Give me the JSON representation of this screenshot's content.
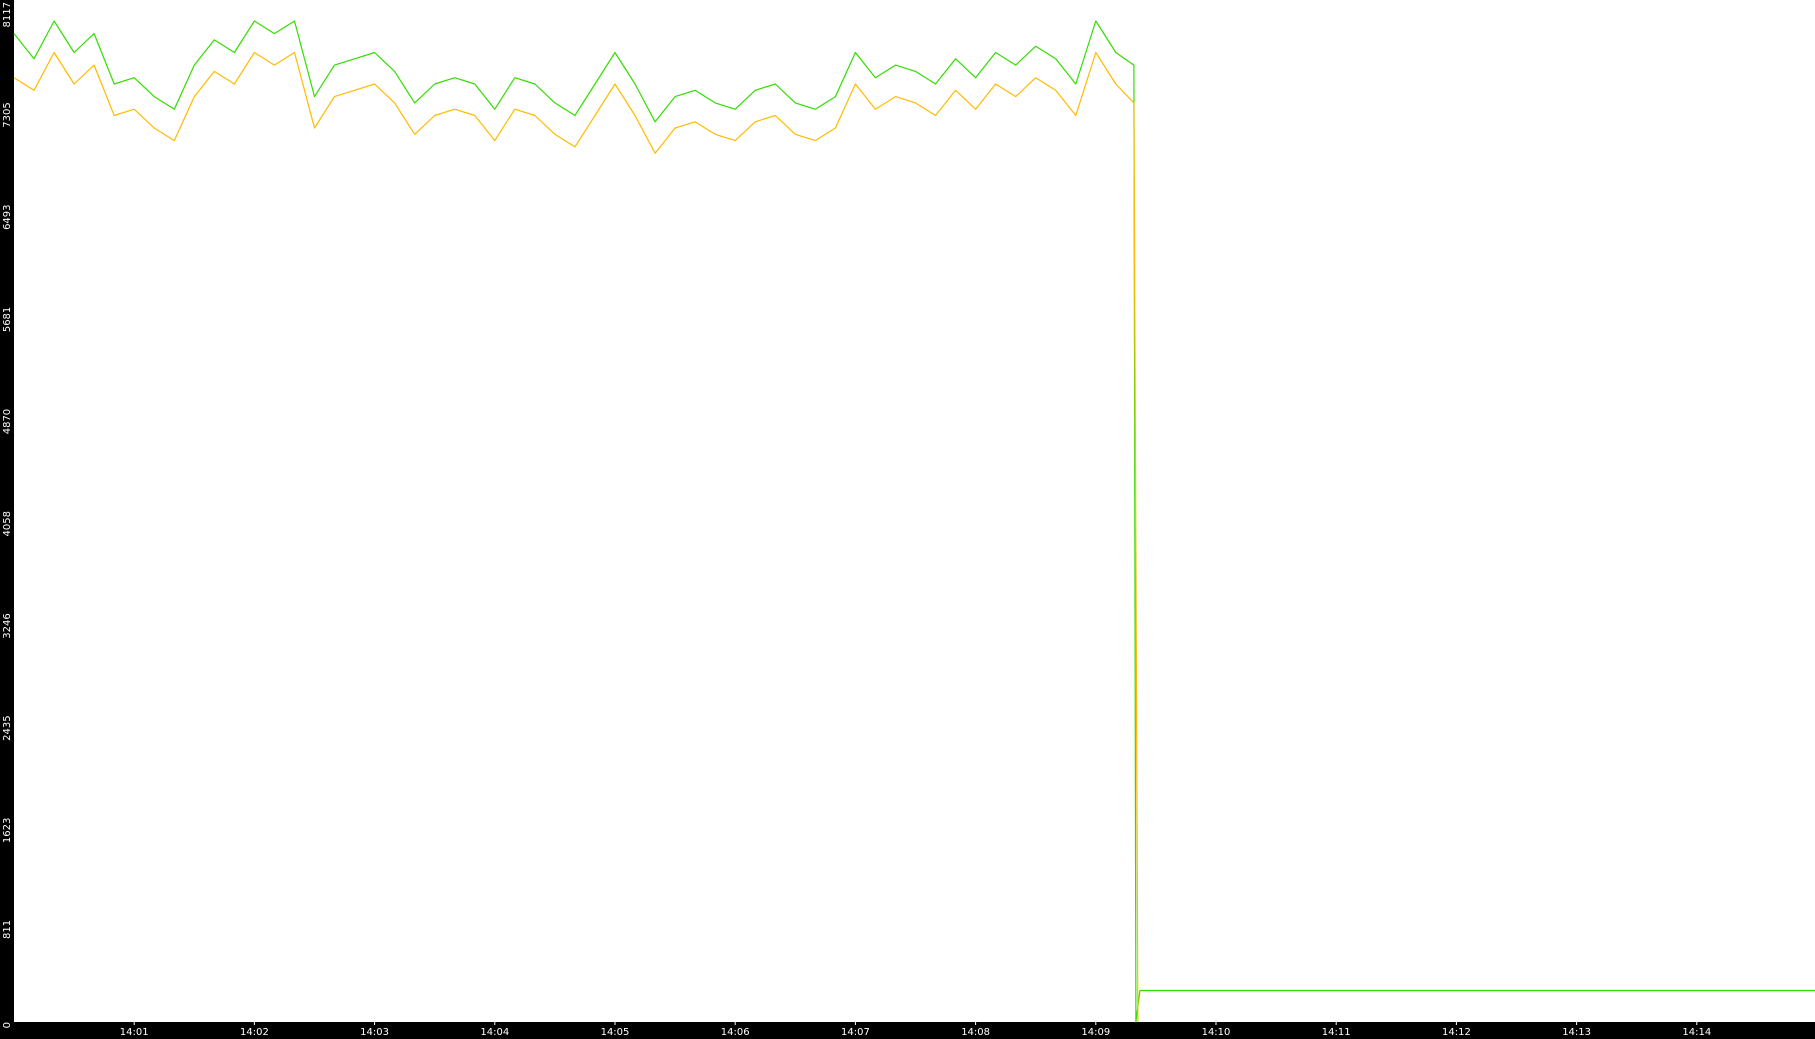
{
  "chart_data": {
    "type": "line",
    "title": "",
    "xlabel": "",
    "ylabel": "",
    "colors": {
      "background": "#ffffff",
      "axis_band": "#000000",
      "tick_text": "#ffffff",
      "series_green": "#33dd00",
      "series_orange": "#ffbb00"
    },
    "y_axis": {
      "range": [
        0,
        8117
      ],
      "ticks": [
        "0",
        "811",
        "1623",
        "2435",
        "3246",
        "4058",
        "4870",
        "5681",
        "6493",
        "7305",
        "8117"
      ]
    },
    "x_axis": {
      "range": [
        "14:00:00",
        "14:14:59"
      ],
      "ticks": [
        "14:01",
        "14:02",
        "14:03",
        "14:04",
        "14:05",
        "14:06",
        "14:07",
        "14:08",
        "14:09",
        "14:10",
        "14:11",
        "14:12",
        "14:13",
        "14:14"
      ]
    },
    "grid": false,
    "legend": "none",
    "series": [
      {
        "color": "#33dd00",
        "points": [
          [
            "14:00:00",
            7850
          ],
          [
            "14:00:10",
            7650
          ],
          [
            "14:00:20",
            7950
          ],
          [
            "14:00:30",
            7700
          ],
          [
            "14:00:40",
            7850
          ],
          [
            "14:00:50",
            7450
          ],
          [
            "14:01:00",
            7500
          ],
          [
            "14:01:10",
            7350
          ],
          [
            "14:01:20",
            7250
          ],
          [
            "14:01:30",
            7600
          ],
          [
            "14:01:40",
            7800
          ],
          [
            "14:01:50",
            7700
          ],
          [
            "14:02:00",
            7950
          ],
          [
            "14:02:10",
            7850
          ],
          [
            "14:02:20",
            7950
          ],
          [
            "14:02:30",
            7350
          ],
          [
            "14:02:40",
            7600
          ],
          [
            "14:02:50",
            7650
          ],
          [
            "14:03:00",
            7700
          ],
          [
            "14:03:10",
            7550
          ],
          [
            "14:03:20",
            7300
          ],
          [
            "14:03:30",
            7450
          ],
          [
            "14:03:40",
            7500
          ],
          [
            "14:03:50",
            7450
          ],
          [
            "14:04:00",
            7250
          ],
          [
            "14:04:10",
            7500
          ],
          [
            "14:04:20",
            7450
          ],
          [
            "14:04:30",
            7300
          ],
          [
            "14:04:40",
            7200
          ],
          [
            "14:04:50",
            7450
          ],
          [
            "14:05:00",
            7700
          ],
          [
            "14:05:10",
            7450
          ],
          [
            "14:05:20",
            7150
          ],
          [
            "14:05:30",
            7350
          ],
          [
            "14:05:40",
            7400
          ],
          [
            "14:05:50",
            7300
          ],
          [
            "14:06:00",
            7250
          ],
          [
            "14:06:10",
            7400
          ],
          [
            "14:06:20",
            7450
          ],
          [
            "14:06:30",
            7300
          ],
          [
            "14:06:40",
            7250
          ],
          [
            "14:06:50",
            7350
          ],
          [
            "14:07:00",
            7700
          ],
          [
            "14:07:10",
            7500
          ],
          [
            "14:07:20",
            7600
          ],
          [
            "14:07:30",
            7550
          ],
          [
            "14:07:40",
            7450
          ],
          [
            "14:07:50",
            7650
          ],
          [
            "14:08:00",
            7500
          ],
          [
            "14:08:10",
            7700
          ],
          [
            "14:08:20",
            7600
          ],
          [
            "14:08:30",
            7750
          ],
          [
            "14:08:40",
            7650
          ],
          [
            "14:08:50",
            7450
          ],
          [
            "14:09:00",
            7950
          ],
          [
            "14:09:10",
            7700
          ],
          [
            "14:09:19",
            7600
          ],
          [
            "14:09:20",
            0
          ],
          [
            "14:09:22",
            250
          ],
          [
            "14:14:59",
            250
          ]
        ]
      },
      {
        "color": "#ffbb00",
        "points": [
          [
            "14:00:00",
            7500
          ],
          [
            "14:00:10",
            7400
          ],
          [
            "14:00:20",
            7700
          ],
          [
            "14:00:30",
            7450
          ],
          [
            "14:00:40",
            7600
          ],
          [
            "14:00:50",
            7200
          ],
          [
            "14:01:00",
            7250
          ],
          [
            "14:01:10",
            7100
          ],
          [
            "14:01:20",
            7000
          ],
          [
            "14:01:30",
            7350
          ],
          [
            "14:01:40",
            7550
          ],
          [
            "14:01:50",
            7450
          ],
          [
            "14:02:00",
            7700
          ],
          [
            "14:02:10",
            7600
          ],
          [
            "14:02:20",
            7700
          ],
          [
            "14:02:30",
            7100
          ],
          [
            "14:02:40",
            7350
          ],
          [
            "14:02:50",
            7400
          ],
          [
            "14:03:00",
            7450
          ],
          [
            "14:03:10",
            7300
          ],
          [
            "14:03:20",
            7050
          ],
          [
            "14:03:30",
            7200
          ],
          [
            "14:03:40",
            7250
          ],
          [
            "14:03:50",
            7200
          ],
          [
            "14:04:00",
            7000
          ],
          [
            "14:04:10",
            7250
          ],
          [
            "14:04:20",
            7200
          ],
          [
            "14:04:30",
            7050
          ],
          [
            "14:04:40",
            6950
          ],
          [
            "14:04:50",
            7200
          ],
          [
            "14:05:00",
            7450
          ],
          [
            "14:05:10",
            7200
          ],
          [
            "14:05:20",
            6900
          ],
          [
            "14:05:30",
            7100
          ],
          [
            "14:05:40",
            7150
          ],
          [
            "14:05:50",
            7050
          ],
          [
            "14:06:00",
            7000
          ],
          [
            "14:06:10",
            7150
          ],
          [
            "14:06:20",
            7200
          ],
          [
            "14:06:30",
            7050
          ],
          [
            "14:06:40",
            7000
          ],
          [
            "14:06:50",
            7100
          ],
          [
            "14:07:00",
            7450
          ],
          [
            "14:07:10",
            7250
          ],
          [
            "14:07:20",
            7350
          ],
          [
            "14:07:30",
            7300
          ],
          [
            "14:07:40",
            7200
          ],
          [
            "14:07:50",
            7400
          ],
          [
            "14:08:00",
            7250
          ],
          [
            "14:08:10",
            7450
          ],
          [
            "14:08:20",
            7350
          ],
          [
            "14:08:30",
            7500
          ],
          [
            "14:08:40",
            7400
          ],
          [
            "14:08:50",
            7200
          ],
          [
            "14:09:00",
            7700
          ],
          [
            "14:09:10",
            7450
          ],
          [
            "14:09:19",
            7300
          ],
          [
            "14:09:20",
            3700
          ],
          [
            "14:09:21",
            0
          ]
        ]
      }
    ]
  }
}
